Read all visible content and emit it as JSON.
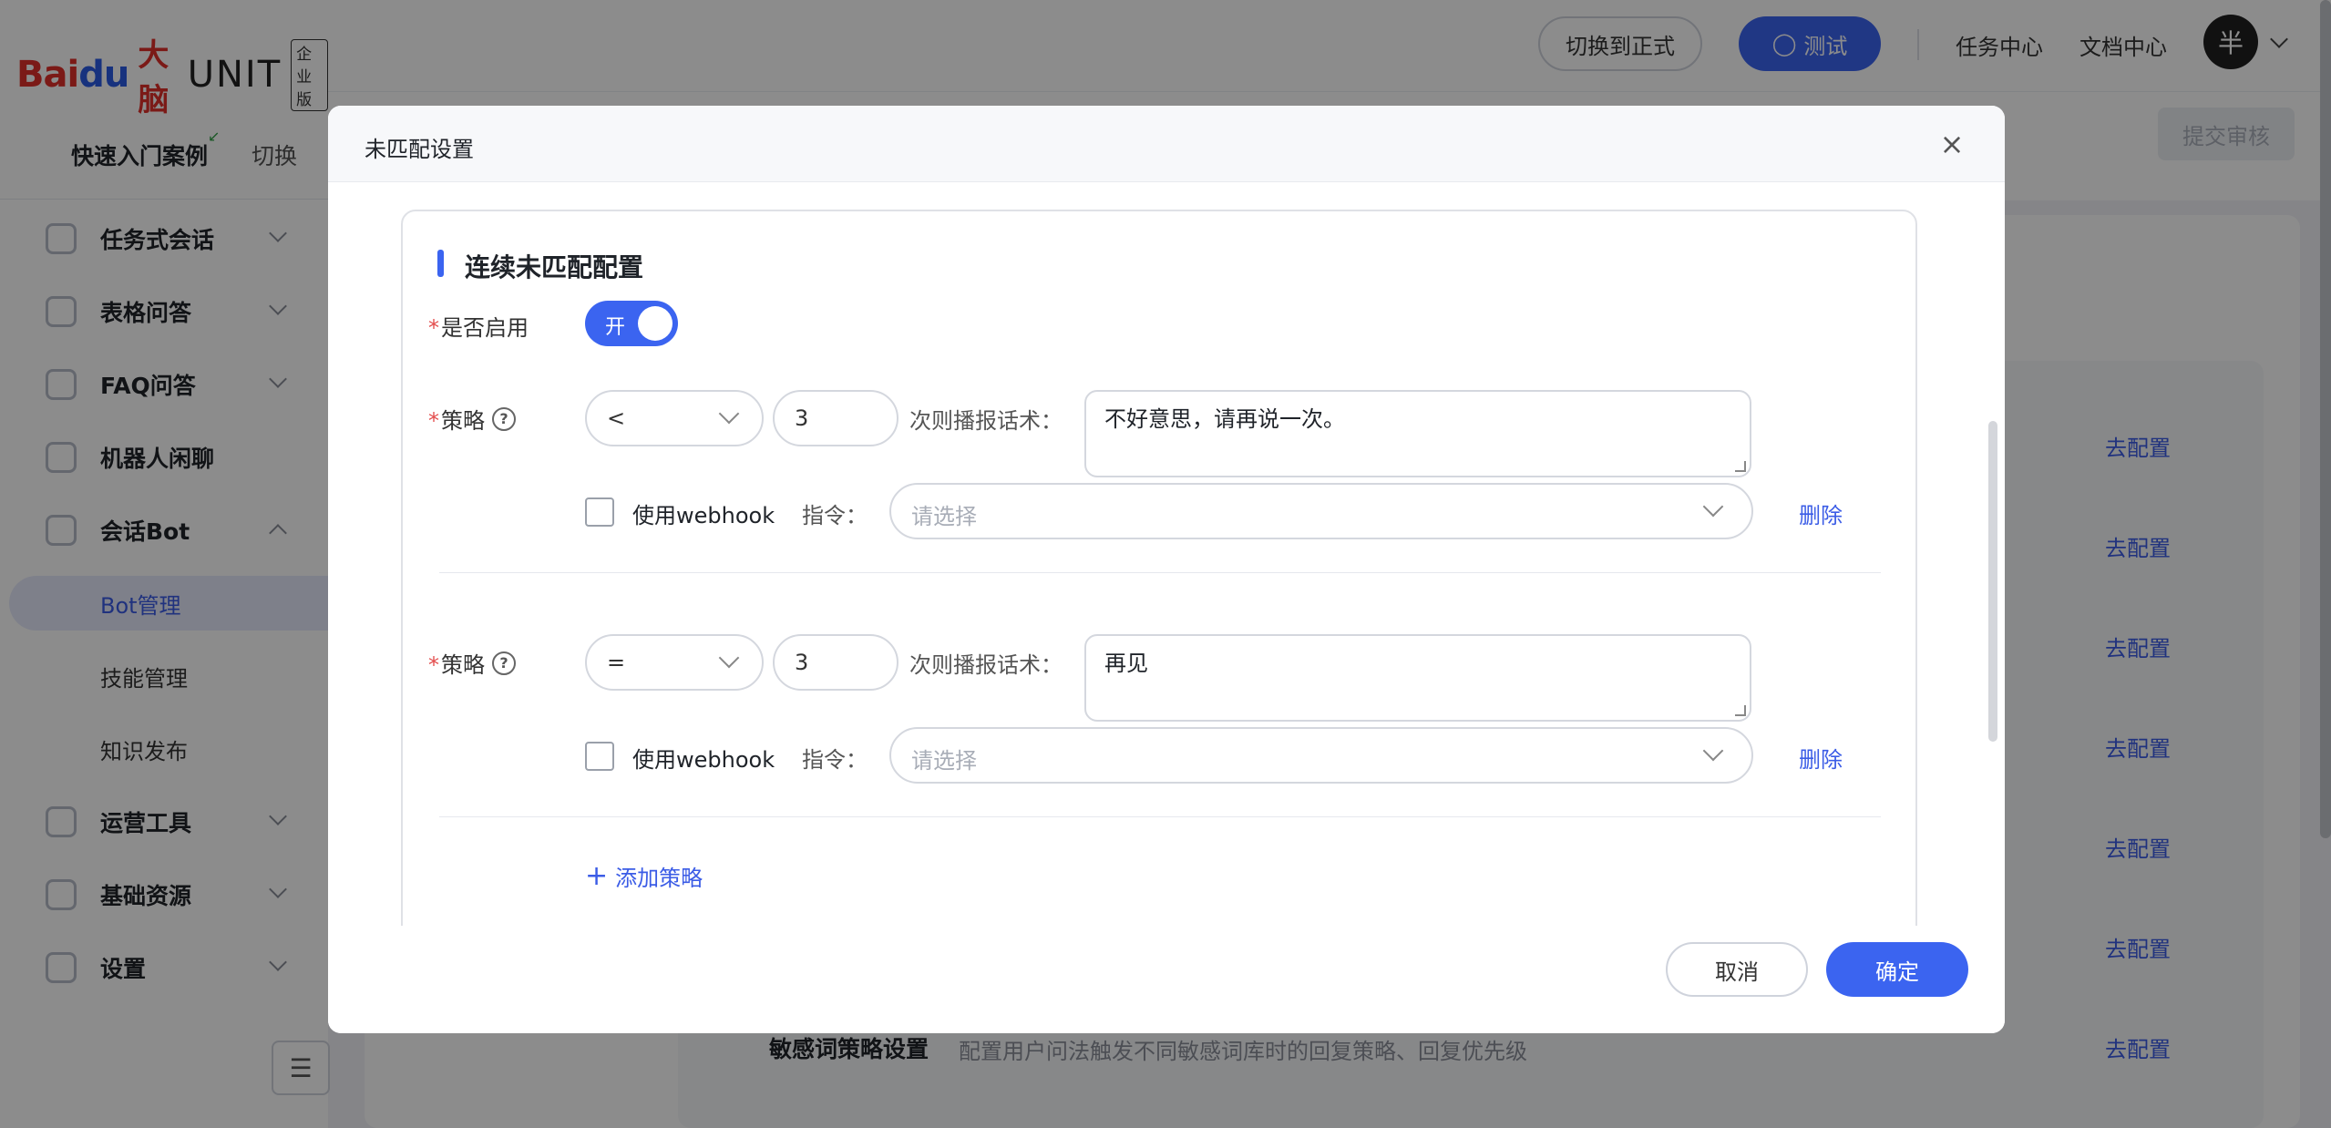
{
  "app": {
    "logo": {
      "bai": "Bai",
      "du": "du",
      "brain": "大脑",
      "unit": "UNIT",
      "edition": "企业版"
    },
    "quick": {
      "tutorial": "快速入门案例",
      "switch": "切换"
    },
    "sidebar": {
      "items": [
        {
          "label": "任务式会话",
          "icon": "task-dialog-icon"
        },
        {
          "label": "表格问答",
          "icon": "table-qa-icon"
        },
        {
          "label": "FAQ问答",
          "icon": "faq-icon"
        },
        {
          "label": "机器人闲聊",
          "icon": "chat-icon"
        },
        {
          "label": "会话Bot",
          "icon": "bot-icon"
        },
        {
          "label": "运营工具",
          "icon": "ops-icon"
        },
        {
          "label": "基础资源",
          "icon": "resource-icon"
        },
        {
          "label": "设置",
          "icon": "settings-icon"
        }
      ],
      "subitems": [
        {
          "label": "Bot管理"
        },
        {
          "label": "技能管理"
        },
        {
          "label": "知识发布"
        }
      ]
    },
    "topbar": {
      "switch_formal": "切换到正式",
      "test": "测试",
      "task_center": "任务中心",
      "docs_center": "文档中心",
      "avatar": "半"
    },
    "subheader": {
      "submit": "提交审核"
    },
    "config_links": [
      "去配置",
      "去配置",
      "去配置",
      "去配置",
      "去配置",
      "去配置",
      "去配置"
    ],
    "bg_row": {
      "title": "敏感词策略设置",
      "desc": "配置用户问法触发不同敏感词库时的回复策略、回复优先级"
    }
  },
  "modal": {
    "title": "未匹配设置",
    "section_title": "连续未匹配配置",
    "enable_label": "是否启用",
    "switch_text": "开",
    "strategies": [
      {
        "label": "策略",
        "operator": "<",
        "count": "3",
        "speech_label": "次则播报话术：",
        "speech": "不好意思，请再说一次。",
        "webhook_label": "使用webhook",
        "command_label": "指令：",
        "command_placeholder": "请选择",
        "delete": "删除"
      },
      {
        "label": "策略",
        "operator": "=",
        "count": "3",
        "speech_label": "次则播报话术：",
        "speech": "再见",
        "webhook_label": "使用webhook",
        "command_label": "指令：",
        "command_placeholder": "请选择",
        "delete": "删除"
      }
    ],
    "add_strategy": "添加策略",
    "cancel": "取消",
    "ok": "确定"
  },
  "colors": {
    "primary": "#3b64f0",
    "danger": "#e34d4d",
    "link": "#3b5ce6"
  }
}
